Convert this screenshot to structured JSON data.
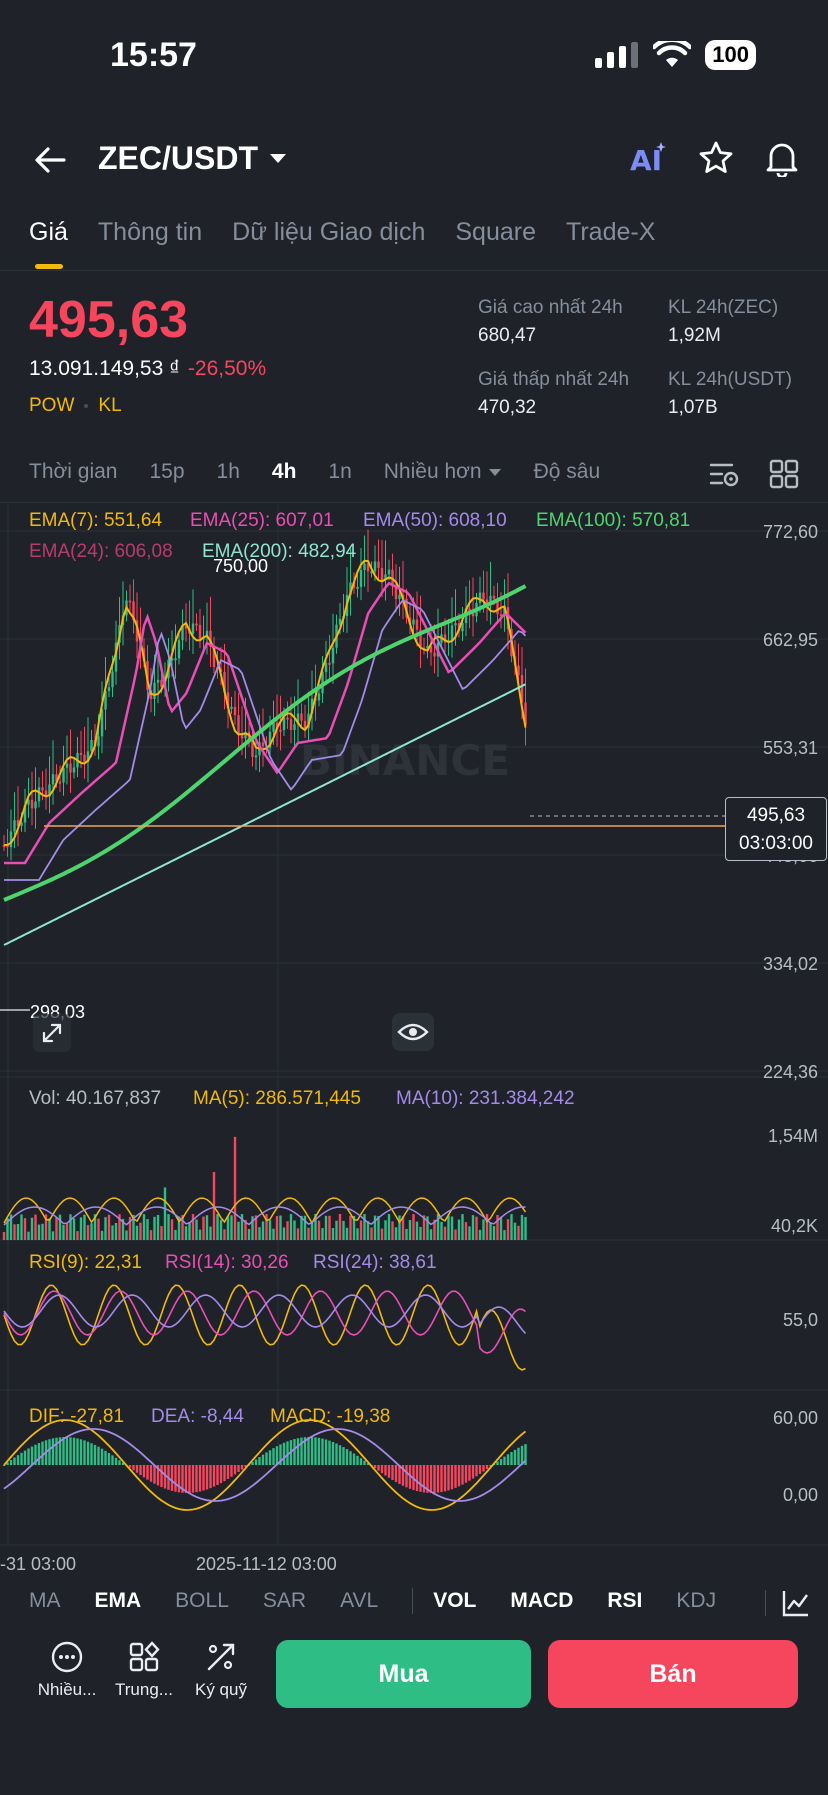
{
  "status": {
    "time": "15:57",
    "battery": "100"
  },
  "header": {
    "pair": "ZEC/USDT"
  },
  "tabs": [
    "Giá",
    "Thông tin",
    "Dữ liệu Giao dịch",
    "Square",
    "Trade-X"
  ],
  "ticker": {
    "price": "495,63",
    "fiat": "13.091.149,53 ₫",
    "change": "-26,50%",
    "tag1": "POW",
    "tag2": "KL",
    "high_label": "Giá cao nhất 24h",
    "high": "680,47",
    "low_label": "Giá thấp nhất 24h",
    "low": "470,32",
    "vol_coin_label": "KL 24h(ZEC)",
    "vol_coin": "1,92M",
    "vol_usdt_label": "KL 24h(USDT)",
    "vol_usdt": "1,07B"
  },
  "intervals": {
    "time": "Thời gian",
    "i1": "15p",
    "i2": "1h",
    "i3": "4h",
    "i4": "1n",
    "more": "Nhiều hơn",
    "depth": "Độ sâu"
  },
  "ema_labels": {
    "ema7": "EMA(7): 551,64",
    "ema25": "EMA(25): 607,01",
    "ema50": "EMA(50): 608,10",
    "ema100": "EMA(100): 570,81",
    "ema24": "EMA(24): 606,08",
    "ema200": "EMA(200): 482,94"
  },
  "price_axis": [
    "772,60",
    "662,95",
    "553,31",
    "443,66",
    "334,02",
    "224,36"
  ],
  "annotations": {
    "high_mark": "750,00",
    "low_mark": "298,03"
  },
  "price_tag": {
    "price": "495,63",
    "countdown": "03:03:00"
  },
  "volume": {
    "vol": "Vol: 40.167,837",
    "ma5": "MA(5): 286.571,445",
    "ma10": "MA(10): 231.384,242",
    "axis_top": "1,54M",
    "axis_bottom": "40,2K"
  },
  "rsi": {
    "rsi9": "RSI(9): 22,31",
    "rsi14": "RSI(14): 30,26",
    "rsi24": "RSI(24): 38,61",
    "axis": "55,0"
  },
  "macd": {
    "dif": "DIF: -27,81",
    "dea": "DEA: -8,44",
    "macd": "MACD: -19,38",
    "axis_top": "60,00",
    "axis_mid": "0,00"
  },
  "time_axis": [
    "-31 03:00",
    "2025-11-12 03:00"
  ],
  "indicator_tabs": [
    "MA",
    "EMA",
    "BOLL",
    "SAR",
    "AVL",
    "VOL",
    "MACD",
    "RSI",
    "KDJ"
  ],
  "bottom": {
    "more": "Nhiều...",
    "markets": "Trung...",
    "margin": "Ký quỹ",
    "buy": "Mua",
    "sell": "Bán"
  },
  "colors": {
    "up": "#2ebd85",
    "down": "#f6465d",
    "accent": "#f0b90b",
    "bg": "#1f2229"
  },
  "watermark": "BINANCE"
}
